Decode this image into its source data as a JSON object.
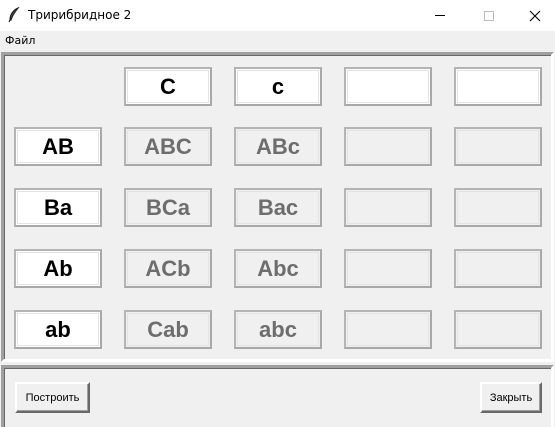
{
  "window": {
    "title": "Тририбридное 2",
    "icon": "feather-icon"
  },
  "menu": {
    "items": [
      {
        "label": "Файл"
      }
    ]
  },
  "grid": {
    "header": [
      "",
      "C",
      "c",
      "",
      ""
    ],
    "rows": [
      {
        "label": "AB",
        "cells": [
          "ABC",
          "ABc",
          "",
          ""
        ]
      },
      {
        "label": "Ba",
        "cells": [
          "BCa",
          "Bac",
          "",
          ""
        ]
      },
      {
        "label": "Ab",
        "cells": [
          "ACb",
          "Abc",
          "",
          ""
        ]
      },
      {
        "label": "ab",
        "cells": [
          "Cab",
          "abc",
          "",
          ""
        ]
      }
    ]
  },
  "buttons": {
    "build": "Построить",
    "close": "Закрыть"
  },
  "colors": {
    "window_bg": "#f0f0f0",
    "label_bg": "#ffffff",
    "result_text": "#6d6d6d"
  }
}
